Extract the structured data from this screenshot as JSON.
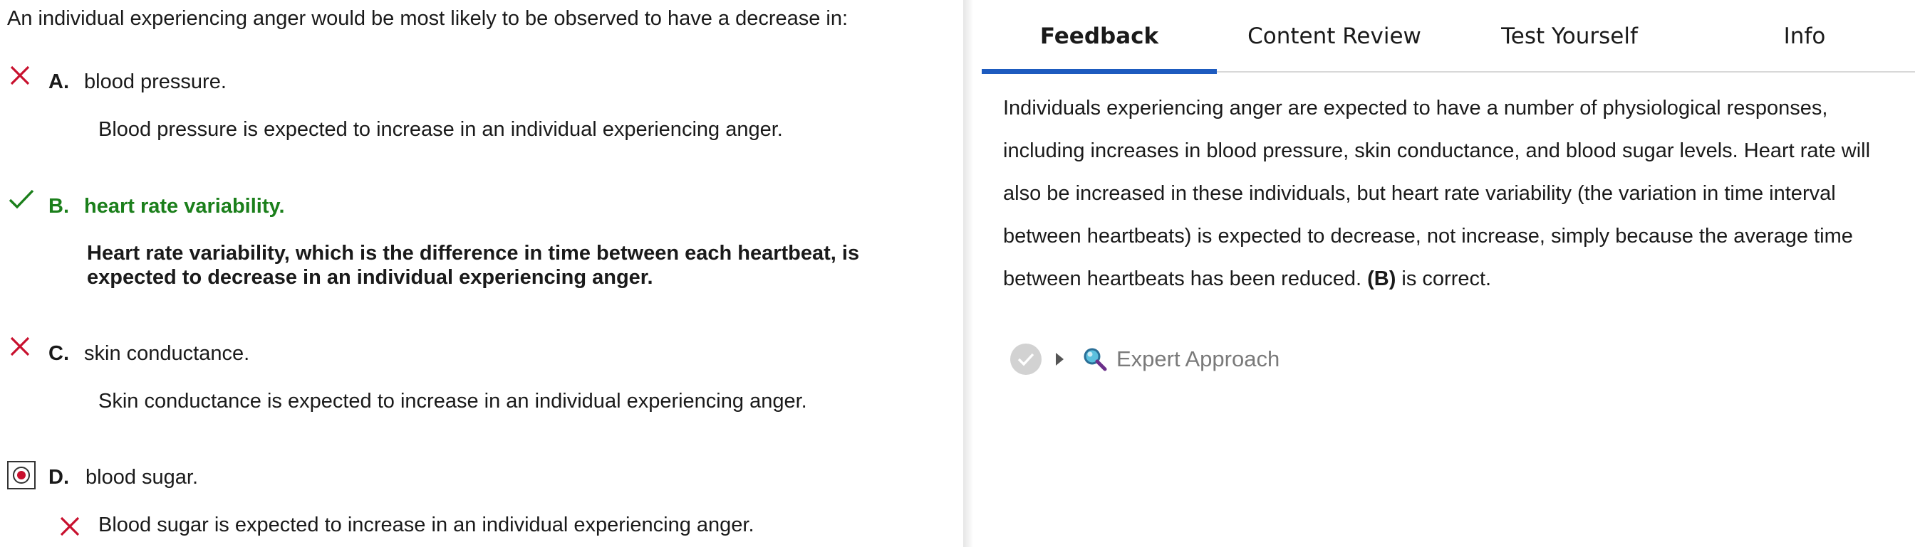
{
  "question": {
    "stem": "An individual experiencing anger would be most likely to be observed to have a decrease in:",
    "options": [
      {
        "letter": "A.",
        "text": "blood pressure.",
        "status": "incorrect",
        "explanation": "Blood pressure is expected to increase in an individual experiencing anger."
      },
      {
        "letter": "B.",
        "text": "heart rate variability.",
        "status": "correct",
        "explanation": "Heart rate variability, which is the difference in time between each heartbeat, is expected to decrease in an individual experiencing anger."
      },
      {
        "letter": "C.",
        "text": "skin conductance.",
        "status": "incorrect",
        "explanation": "Skin conductance is expected to increase in an individual experiencing anger."
      },
      {
        "letter": "D.",
        "text": "blood sugar.",
        "status": "selected-incorrect",
        "explanation": "Blood sugar is expected to increase in an individual experiencing anger."
      }
    ]
  },
  "tabs": [
    {
      "label": "Feedback",
      "active": true
    },
    {
      "label": "Content Review",
      "active": false
    },
    {
      "label": "Test Yourself",
      "active": false
    },
    {
      "label": "Info",
      "active": false
    }
  ],
  "feedback": {
    "text_before_bold": "Individuals experiencing anger are expected to have a number of physiological responses, including increases in blood pressure, skin conductance, and blood sugar levels. Heart rate will also be increased in these individuals, but heart rate variability (the variation in time interval between heartbeats) is expected to decrease, not increase, simply because the average time between heartbeats has been reduced. ",
    "bold": "(B)",
    "text_after_bold": " is correct."
  },
  "expert_approach": {
    "label": "Expert Approach"
  },
  "colors": {
    "correct_green": "#1b7f1b",
    "incorrect_red": "#c8102e",
    "tab_accent": "#1d5bbf",
    "muted_label": "#7a7a7a"
  },
  "icons": [
    "x-icon",
    "check-icon",
    "radio-selected-icon",
    "caret-right-icon",
    "magnifier-icon",
    "check-circle-icon"
  ]
}
